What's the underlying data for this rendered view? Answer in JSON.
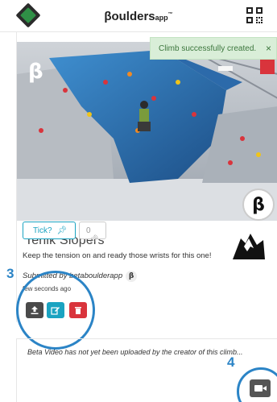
{
  "header": {
    "brand_main": "βoulders",
    "brand_app": "app",
    "brand_tm": "™"
  },
  "toast": {
    "message": "Climb successfully created.",
    "close_label": "×"
  },
  "photo": {
    "beta_badge": "β",
    "beta_circle": "β"
  },
  "climb": {
    "name": "Tenik Slopers",
    "tick_label": "Tick?",
    "tick_icon": "pin-icon",
    "tick_count": "0",
    "description": "Keep the tension on and ready those wrists for this one!",
    "submitted_by": "Submitted by betaboulderapp",
    "submitted_badge": "β",
    "posted_time": "few seconds ago"
  },
  "actions": {
    "upload_icon": "upload-icon",
    "edit_icon": "edit-icon",
    "delete_icon": "trash-icon"
  },
  "annotations": {
    "num_3": "3",
    "num_4": "4"
  },
  "video": {
    "message": "Beta Video has not yet been uploaded by the creator of this climb...",
    "camera_icon": "video-camera-icon"
  },
  "colors": {
    "accent": "#1aa3c1",
    "danger": "#d9343c",
    "toast_bg": "#d9eed8",
    "annotation": "#2b84c6"
  }
}
